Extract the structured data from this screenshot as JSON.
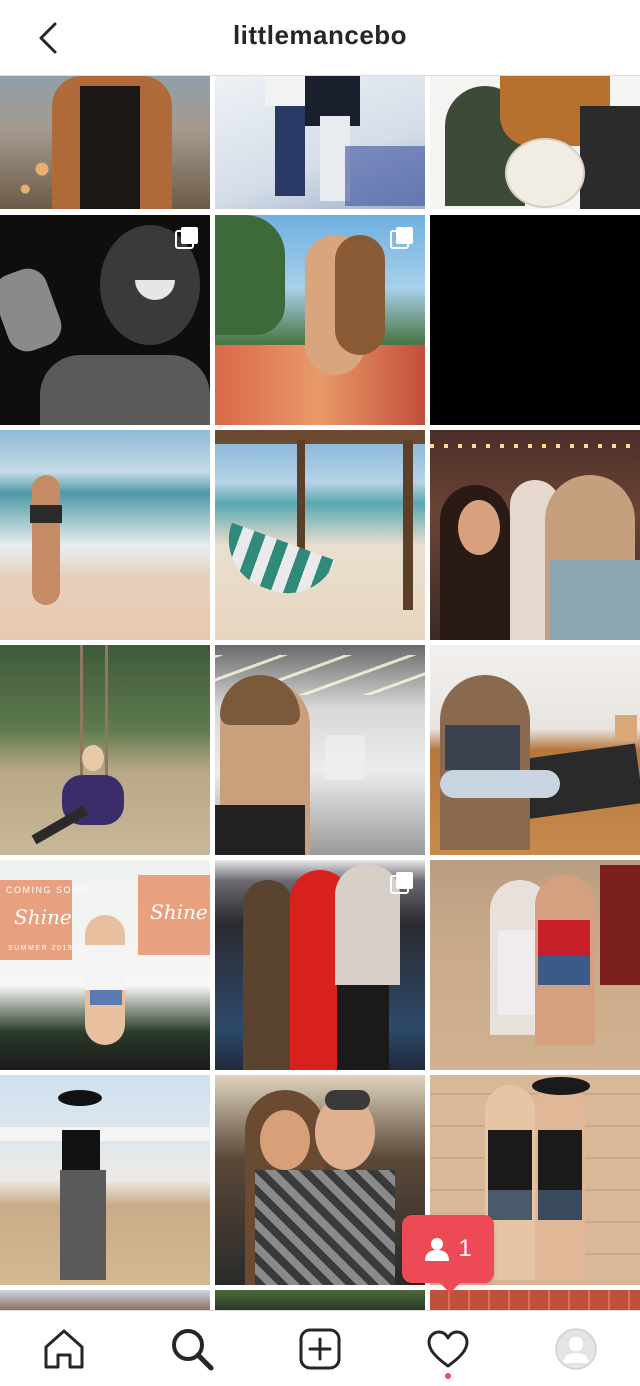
{
  "header": {
    "title": "littlemancebo",
    "back_icon": "chevron-left-icon"
  },
  "tiles": [
    {
      "label": "post-1",
      "multi": false
    },
    {
      "label": "post-2",
      "multi": false
    },
    {
      "label": "post-3",
      "multi": false
    },
    {
      "label": "post-4",
      "multi": true
    },
    {
      "label": "post-5",
      "multi": true
    },
    {
      "label": "post-6",
      "multi": false
    },
    {
      "label": "post-7",
      "multi": false
    },
    {
      "label": "post-8",
      "multi": false
    },
    {
      "label": "post-9",
      "multi": false
    },
    {
      "label": "post-10",
      "multi": false
    },
    {
      "label": "post-11",
      "multi": false
    },
    {
      "label": "post-12",
      "multi": false
    },
    {
      "label": "post-13",
      "multi": false,
      "text": [
        "COMING SOON",
        "Shine",
        "SUMMER 2019"
      ]
    },
    {
      "label": "post-14",
      "multi": true
    },
    {
      "label": "post-15",
      "multi": false
    },
    {
      "label": "post-16",
      "multi": false
    },
    {
      "label": "post-17",
      "multi": false
    },
    {
      "label": "post-18",
      "multi": false
    }
  ],
  "notification": {
    "count": "1",
    "icon": "person-icon",
    "color": "#ed4956"
  },
  "nav": {
    "items": [
      {
        "name": "home",
        "icon": "home-icon"
      },
      {
        "name": "search",
        "icon": "search-icon"
      },
      {
        "name": "add",
        "icon": "plus-square-icon"
      },
      {
        "name": "activity",
        "icon": "heart-icon"
      },
      {
        "name": "profile",
        "icon": "avatar-icon"
      }
    ]
  }
}
